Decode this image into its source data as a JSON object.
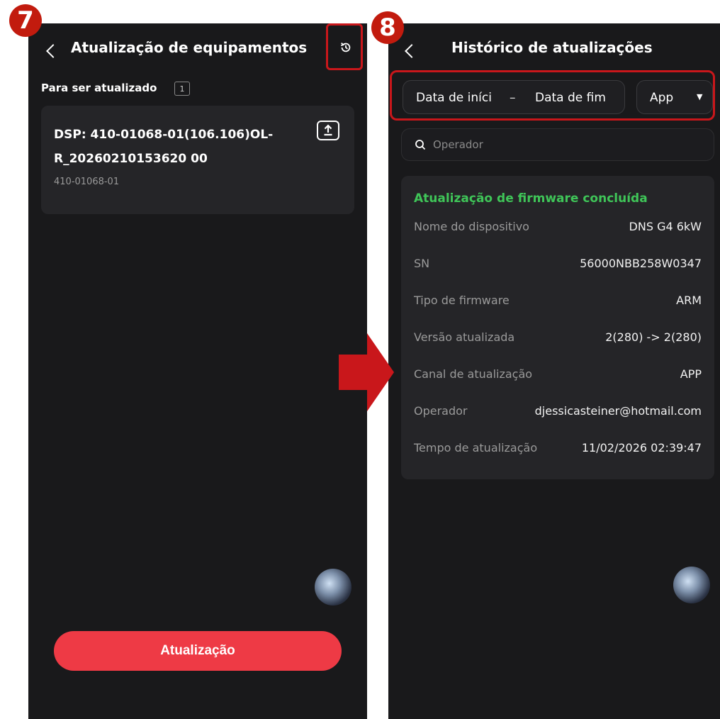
{
  "annotations": {
    "step_left": "7",
    "step_right": "8",
    "accent": "#c9171b"
  },
  "left_screen": {
    "title": "Atualização de equipamentos",
    "icons": {
      "back": "back-chevron-icon",
      "history": "history-clock-icon",
      "upload": "upload-icon"
    },
    "pending_label": "Para ser atualizado",
    "pending_count": "1",
    "device": {
      "name": "DSP: 410-01068-01(106.106)OL-R_20260210153620 00",
      "part_number": "410-01068-01"
    },
    "update_button": "Atualização",
    "colors": {
      "background": "#19191b",
      "card": "#252528",
      "button": "#ee3a45"
    }
  },
  "right_screen": {
    "title": "Histórico de atualizações",
    "filters": {
      "start_date": "Data de iníci",
      "separator": "–",
      "end_date": "Data de fim",
      "source": "App"
    },
    "search": {
      "placeholder": "Operador"
    },
    "record": {
      "status": "Atualização de firmware concluída",
      "status_color": "#3fc558",
      "rows": [
        {
          "label": "Nome do dispositivo",
          "value": "DNS G4 6kW"
        },
        {
          "label": "SN",
          "value": "56000NBB258W0347"
        },
        {
          "label": "Tipo de firmware",
          "value": "ARM"
        },
        {
          "label": "Versão atualizada",
          "value": "2(280) -> 2(280)"
        },
        {
          "label": "Canal de atualização",
          "value": "APP"
        },
        {
          "label": "Operador",
          "value": "djessicasteiner@hotmail.com"
        },
        {
          "label": "Tempo de atualização",
          "value": "11/02/2026 02:39:47"
        }
      ]
    }
  }
}
